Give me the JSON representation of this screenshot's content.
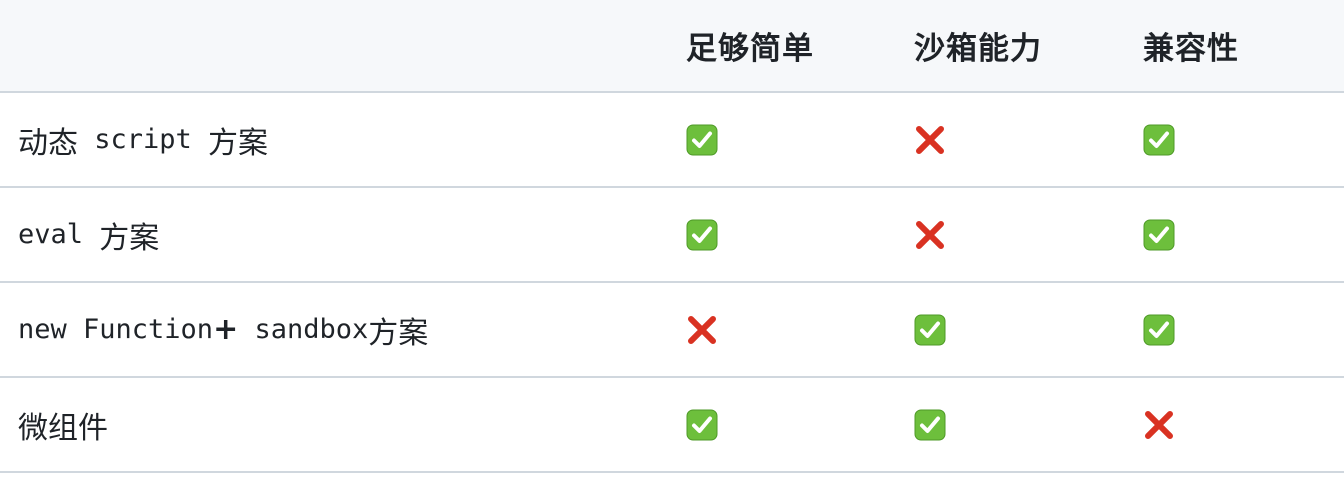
{
  "table": {
    "headers": [
      "",
      "足够简单",
      "沙箱能力",
      "兼容性"
    ],
    "rows": [
      {
        "label_parts": [
          {
            "text": "动态",
            "style": "text"
          },
          {
            "text": " script ",
            "style": "code"
          },
          {
            "text": "方案",
            "style": "text"
          }
        ],
        "values": [
          "check-icon",
          "cross-icon",
          "check-icon"
        ]
      },
      {
        "label_parts": [
          {
            "text": "eval ",
            "style": "code"
          },
          {
            "text": "方案",
            "style": "text"
          }
        ],
        "values": [
          "check-icon",
          "cross-icon",
          "check-icon"
        ]
      },
      {
        "label_parts": [
          {
            "text": "new Function",
            "style": "code"
          },
          {
            "text": "+",
            "style": "plus"
          },
          {
            "text": " sandbox",
            "style": "code"
          },
          {
            "text": "方案",
            "style": "text"
          }
        ],
        "values": [
          "cross-icon",
          "check-icon",
          "check-icon"
        ]
      },
      {
        "label_parts": [
          {
            "text": "微组件",
            "style": "text"
          }
        ],
        "values": [
          "check-icon",
          "check-icon",
          "cross-icon"
        ]
      }
    ]
  },
  "colors": {
    "check_bg": "#6dbf3c",
    "check_border": "#4e9a27",
    "cross": "#d93222",
    "header_bg": "#f6f8fa",
    "border": "#d0d7de"
  }
}
